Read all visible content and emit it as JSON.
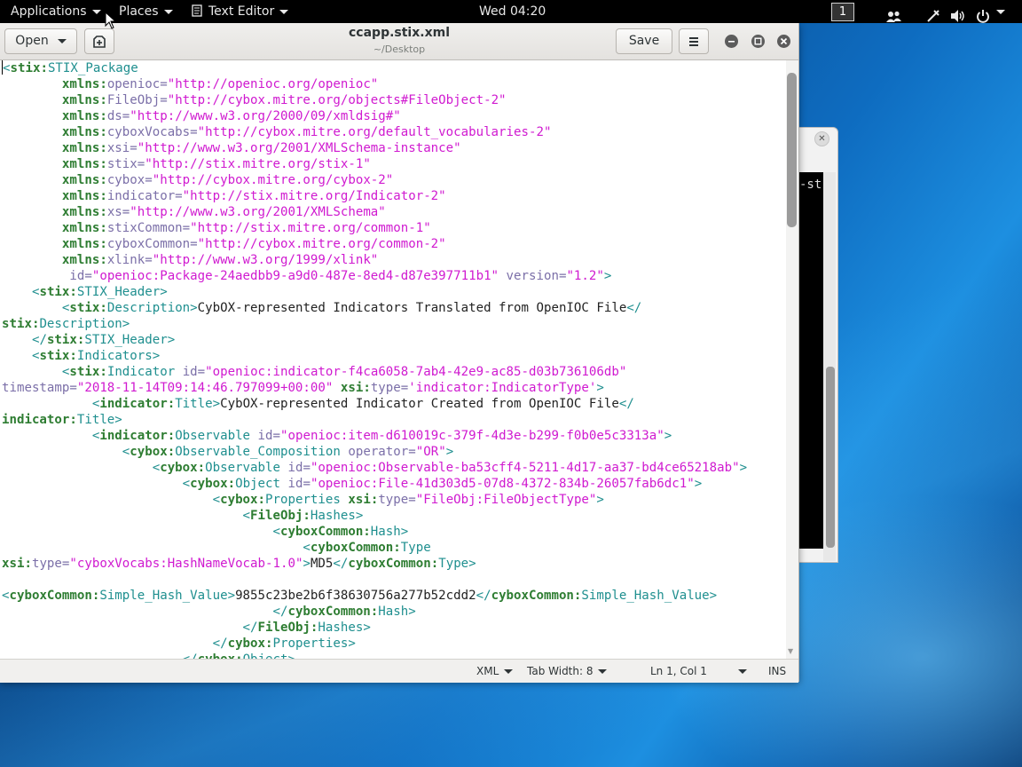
{
  "topbar": {
    "applications": "Applications",
    "places": "Places",
    "app_menu": "Text Editor",
    "clock": "Wed 04:20",
    "workspace": "1"
  },
  "window": {
    "title": "ccapp.stix.xml",
    "subtitle": "~/Desktop",
    "open_label": "Open",
    "save_label": "Save"
  },
  "editor": {
    "lines": [
      [
        [
          "t",
          "<"
        ],
        [
          "ns",
          "stix:"
        ],
        [
          "t",
          "STIX_Package"
        ]
      ],
      [
        [
          "x",
          "        "
        ],
        [
          "ns",
          "xmlns:"
        ],
        [
          "an",
          "openioc="
        ],
        [
          "v",
          "\"http://openioc.org/openioc\""
        ]
      ],
      [
        [
          "x",
          "        "
        ],
        [
          "ns",
          "xmlns:"
        ],
        [
          "an",
          "FileObj="
        ],
        [
          "v",
          "\"http://cybox.mitre.org/objects#FileObject-2\""
        ]
      ],
      [
        [
          "x",
          "        "
        ],
        [
          "ns",
          "xmlns:"
        ],
        [
          "an",
          "ds="
        ],
        [
          "v",
          "\"http://www.w3.org/2000/09/xmldsig#\""
        ]
      ],
      [
        [
          "x",
          "        "
        ],
        [
          "ns",
          "xmlns:"
        ],
        [
          "an",
          "cyboxVocabs="
        ],
        [
          "v",
          "\"http://cybox.mitre.org/default_vocabularies-2\""
        ]
      ],
      [
        [
          "x",
          "        "
        ],
        [
          "ns",
          "xmlns:"
        ],
        [
          "an",
          "xsi="
        ],
        [
          "v",
          "\"http://www.w3.org/2001/XMLSchema-instance\""
        ]
      ],
      [
        [
          "x",
          "        "
        ],
        [
          "ns",
          "xmlns:"
        ],
        [
          "an",
          "stix="
        ],
        [
          "v",
          "\"http://stix.mitre.org/stix-1\""
        ]
      ],
      [
        [
          "x",
          "        "
        ],
        [
          "ns",
          "xmlns:"
        ],
        [
          "an",
          "cybox="
        ],
        [
          "v",
          "\"http://cybox.mitre.org/cybox-2\""
        ]
      ],
      [
        [
          "x",
          "        "
        ],
        [
          "ns",
          "xmlns:"
        ],
        [
          "an",
          "indicator="
        ],
        [
          "v",
          "\"http://stix.mitre.org/Indicator-2\""
        ]
      ],
      [
        [
          "x",
          "        "
        ],
        [
          "ns",
          "xmlns:"
        ],
        [
          "an",
          "xs="
        ],
        [
          "v",
          "\"http://www.w3.org/2001/XMLSchema\""
        ]
      ],
      [
        [
          "x",
          "        "
        ],
        [
          "ns",
          "xmlns:"
        ],
        [
          "an",
          "stixCommon="
        ],
        [
          "v",
          "\"http://stix.mitre.org/common-1\""
        ]
      ],
      [
        [
          "x",
          "        "
        ],
        [
          "ns",
          "xmlns:"
        ],
        [
          "an",
          "cyboxCommon="
        ],
        [
          "v",
          "\"http://cybox.mitre.org/common-2\""
        ]
      ],
      [
        [
          "x",
          "        "
        ],
        [
          "ns",
          "xmlns:"
        ],
        [
          "an",
          "xlink="
        ],
        [
          "v",
          "\"http://www.w3.org/1999/xlink\""
        ]
      ],
      [
        [
          "x",
          "         "
        ],
        [
          "an",
          "id="
        ],
        [
          "v",
          "\"openioc:Package-24aedbb9-a9d0-487e-8ed4-d87e397711b1\""
        ],
        [
          "x",
          " "
        ],
        [
          "an",
          "version="
        ],
        [
          "v",
          "\"1.2\""
        ],
        [
          "t",
          ">"
        ]
      ],
      [
        [
          "x",
          "    "
        ],
        [
          "t",
          "<"
        ],
        [
          "ns",
          "stix:"
        ],
        [
          "t",
          "STIX_Header>"
        ]
      ],
      [
        [
          "x",
          "        "
        ],
        [
          "t",
          "<"
        ],
        [
          "ns",
          "stix:"
        ],
        [
          "t",
          "Description>"
        ],
        [
          "x",
          "CybOX-represented Indicators Translated from OpenIOC File"
        ],
        [
          "t",
          "</"
        ]
      ],
      [
        [
          "ns",
          "stix:"
        ],
        [
          "t",
          "Description>"
        ]
      ],
      [
        [
          "x",
          "    "
        ],
        [
          "t",
          "</"
        ],
        [
          "ns",
          "stix:"
        ],
        [
          "t",
          "STIX_Header>"
        ]
      ],
      [
        [
          "x",
          "    "
        ],
        [
          "t",
          "<"
        ],
        [
          "ns",
          "stix:"
        ],
        [
          "t",
          "Indicators>"
        ]
      ],
      [
        [
          "x",
          "        "
        ],
        [
          "t",
          "<"
        ],
        [
          "ns",
          "stix:"
        ],
        [
          "t",
          "Indicator "
        ],
        [
          "an",
          "id="
        ],
        [
          "v",
          "\"openioc:indicator-f4ca6058-7ab4-42e9-ac85-d03b736106db\""
        ]
      ],
      [
        [
          "an",
          "timestamp="
        ],
        [
          "v",
          "\"2018-11-14T09:14:46.797099+00:00\""
        ],
        [
          "x",
          " "
        ],
        [
          "ns",
          "xsi:"
        ],
        [
          "an",
          "type="
        ],
        [
          "v",
          "'indicator:IndicatorType'"
        ],
        [
          "t",
          ">"
        ]
      ],
      [
        [
          "x",
          "            "
        ],
        [
          "t",
          "<"
        ],
        [
          "ns",
          "indicator:"
        ],
        [
          "t",
          "Title>"
        ],
        [
          "x",
          "CybOX-represented Indicator Created from OpenIOC File"
        ],
        [
          "t",
          "</"
        ]
      ],
      [
        [
          "ns",
          "indicator:"
        ],
        [
          "t",
          "Title>"
        ]
      ],
      [
        [
          "x",
          "            "
        ],
        [
          "t",
          "<"
        ],
        [
          "ns",
          "indicator:"
        ],
        [
          "t",
          "Observable "
        ],
        [
          "an",
          "id="
        ],
        [
          "v",
          "\"openioc:item-d610019c-379f-4d3e-b299-f0b0e5c3313a\""
        ],
        [
          "t",
          ">"
        ]
      ],
      [
        [
          "x",
          "                "
        ],
        [
          "t",
          "<"
        ],
        [
          "ns",
          "cybox:"
        ],
        [
          "t",
          "Observable_Composition "
        ],
        [
          "an",
          "operator="
        ],
        [
          "v",
          "\"OR\""
        ],
        [
          "t",
          ">"
        ]
      ],
      [
        [
          "x",
          "                    "
        ],
        [
          "t",
          "<"
        ],
        [
          "ns",
          "cybox:"
        ],
        [
          "t",
          "Observable "
        ],
        [
          "an",
          "id="
        ],
        [
          "v",
          "\"openioc:Observable-ba53cff4-5211-4d17-aa37-bd4ce65218ab\""
        ],
        [
          "t",
          ">"
        ]
      ],
      [
        [
          "x",
          "                        "
        ],
        [
          "t",
          "<"
        ],
        [
          "ns",
          "cybox:"
        ],
        [
          "t",
          "Object "
        ],
        [
          "an",
          "id="
        ],
        [
          "v",
          "\"openioc:File-41d303d5-07d8-4372-834b-26057fab6dc1\""
        ],
        [
          "t",
          ">"
        ]
      ],
      [
        [
          "x",
          "                            "
        ],
        [
          "t",
          "<"
        ],
        [
          "ns",
          "cybox:"
        ],
        [
          "t",
          "Properties "
        ],
        [
          "ns",
          "xsi:"
        ],
        [
          "an",
          "type="
        ],
        [
          "v",
          "\"FileObj:FileObjectType\""
        ],
        [
          "t",
          ">"
        ]
      ],
      [
        [
          "x",
          "                                "
        ],
        [
          "t",
          "<"
        ],
        [
          "ns",
          "FileObj:"
        ],
        [
          "t",
          "Hashes>"
        ]
      ],
      [
        [
          "x",
          "                                    "
        ],
        [
          "t",
          "<"
        ],
        [
          "ns",
          "cyboxCommon:"
        ],
        [
          "t",
          "Hash>"
        ]
      ],
      [
        [
          "x",
          "                                        "
        ],
        [
          "t",
          "<"
        ],
        [
          "ns",
          "cyboxCommon:"
        ],
        [
          "t",
          "Type"
        ]
      ],
      [
        [
          "ns",
          "xsi:"
        ],
        [
          "an",
          "type="
        ],
        [
          "v",
          "\"cyboxVocabs:HashNameVocab-1.0\""
        ],
        [
          "t",
          ">"
        ],
        [
          "x",
          "MD5"
        ],
        [
          "t",
          "</"
        ],
        [
          "ns",
          "cyboxCommon:"
        ],
        [
          "t",
          "Type>"
        ]
      ],
      [
        [
          "x",
          ""
        ]
      ],
      [
        [
          "t",
          "<"
        ],
        [
          "ns",
          "cyboxCommon:"
        ],
        [
          "t",
          "Simple_Hash_Value>"
        ],
        [
          "x",
          "9855c23be2b6f38630756a277b52cdd2"
        ],
        [
          "t",
          "</"
        ],
        [
          "ns",
          "cyboxCommon:"
        ],
        [
          "t",
          "Simple_Hash_Value>"
        ]
      ],
      [
        [
          "x",
          "                                    "
        ],
        [
          "t",
          "</"
        ],
        [
          "ns",
          "cyboxCommon:"
        ],
        [
          "t",
          "Hash>"
        ]
      ],
      [
        [
          "x",
          "                                "
        ],
        [
          "t",
          "</"
        ],
        [
          "ns",
          "FileObj:"
        ],
        [
          "t",
          "Hashes>"
        ]
      ],
      [
        [
          "x",
          "                            "
        ],
        [
          "t",
          "</"
        ],
        [
          "ns",
          "cybox:"
        ],
        [
          "t",
          "Properties>"
        ]
      ],
      [
        [
          "x",
          "                        "
        ],
        [
          "t",
          "</"
        ],
        [
          "ns",
          "cybox:"
        ],
        [
          "t",
          "Object>"
        ]
      ]
    ]
  },
  "statusbar": {
    "language": "XML",
    "tab_width": "Tab Width: 8",
    "position": "Ln 1, Col 1",
    "mode": "INS"
  },
  "background_window": {
    "terminal_text": "-st"
  }
}
